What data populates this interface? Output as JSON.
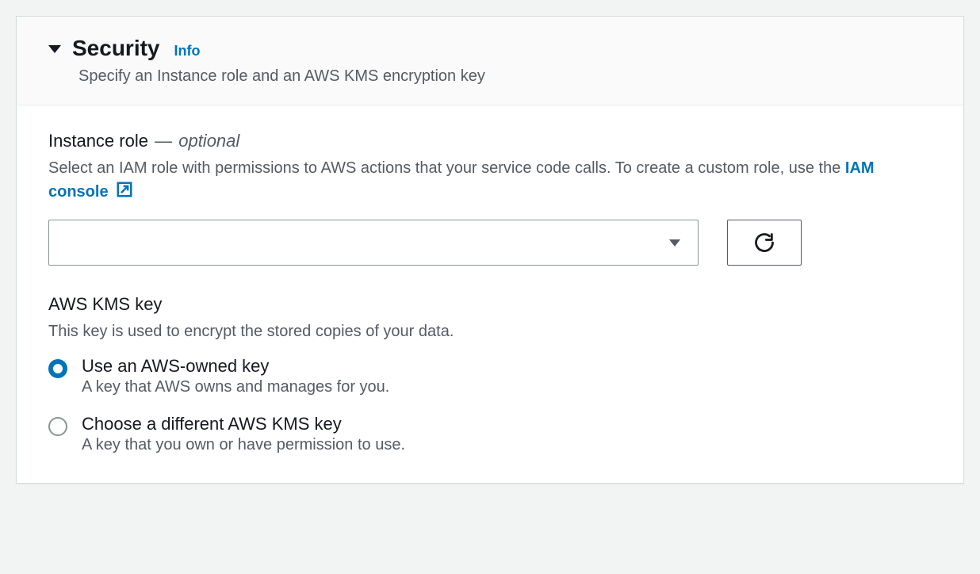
{
  "header": {
    "toggle_expanded": true,
    "title": "Security",
    "info_label": "Info",
    "subtitle": "Specify an Instance role and an AWS KMS encryption key"
  },
  "instance_role": {
    "label": "Instance role",
    "optional_text": "optional",
    "description_pre": "Select an IAM role with permissions to AWS actions that your service code calls. To create a custom role, use the ",
    "link_text": "IAM console",
    "select_value": "",
    "refresh_aria": "Refresh instance roles"
  },
  "kms": {
    "label": "AWS KMS key",
    "description": "This key is used to encrypt the stored copies of your data.",
    "options": [
      {
        "label": "Use an AWS-owned key",
        "description": "A key that AWS owns and manages for you.",
        "selected": true
      },
      {
        "label": "Choose a different AWS KMS key",
        "description": "A key that you own or have permission to use.",
        "selected": false
      }
    ]
  }
}
